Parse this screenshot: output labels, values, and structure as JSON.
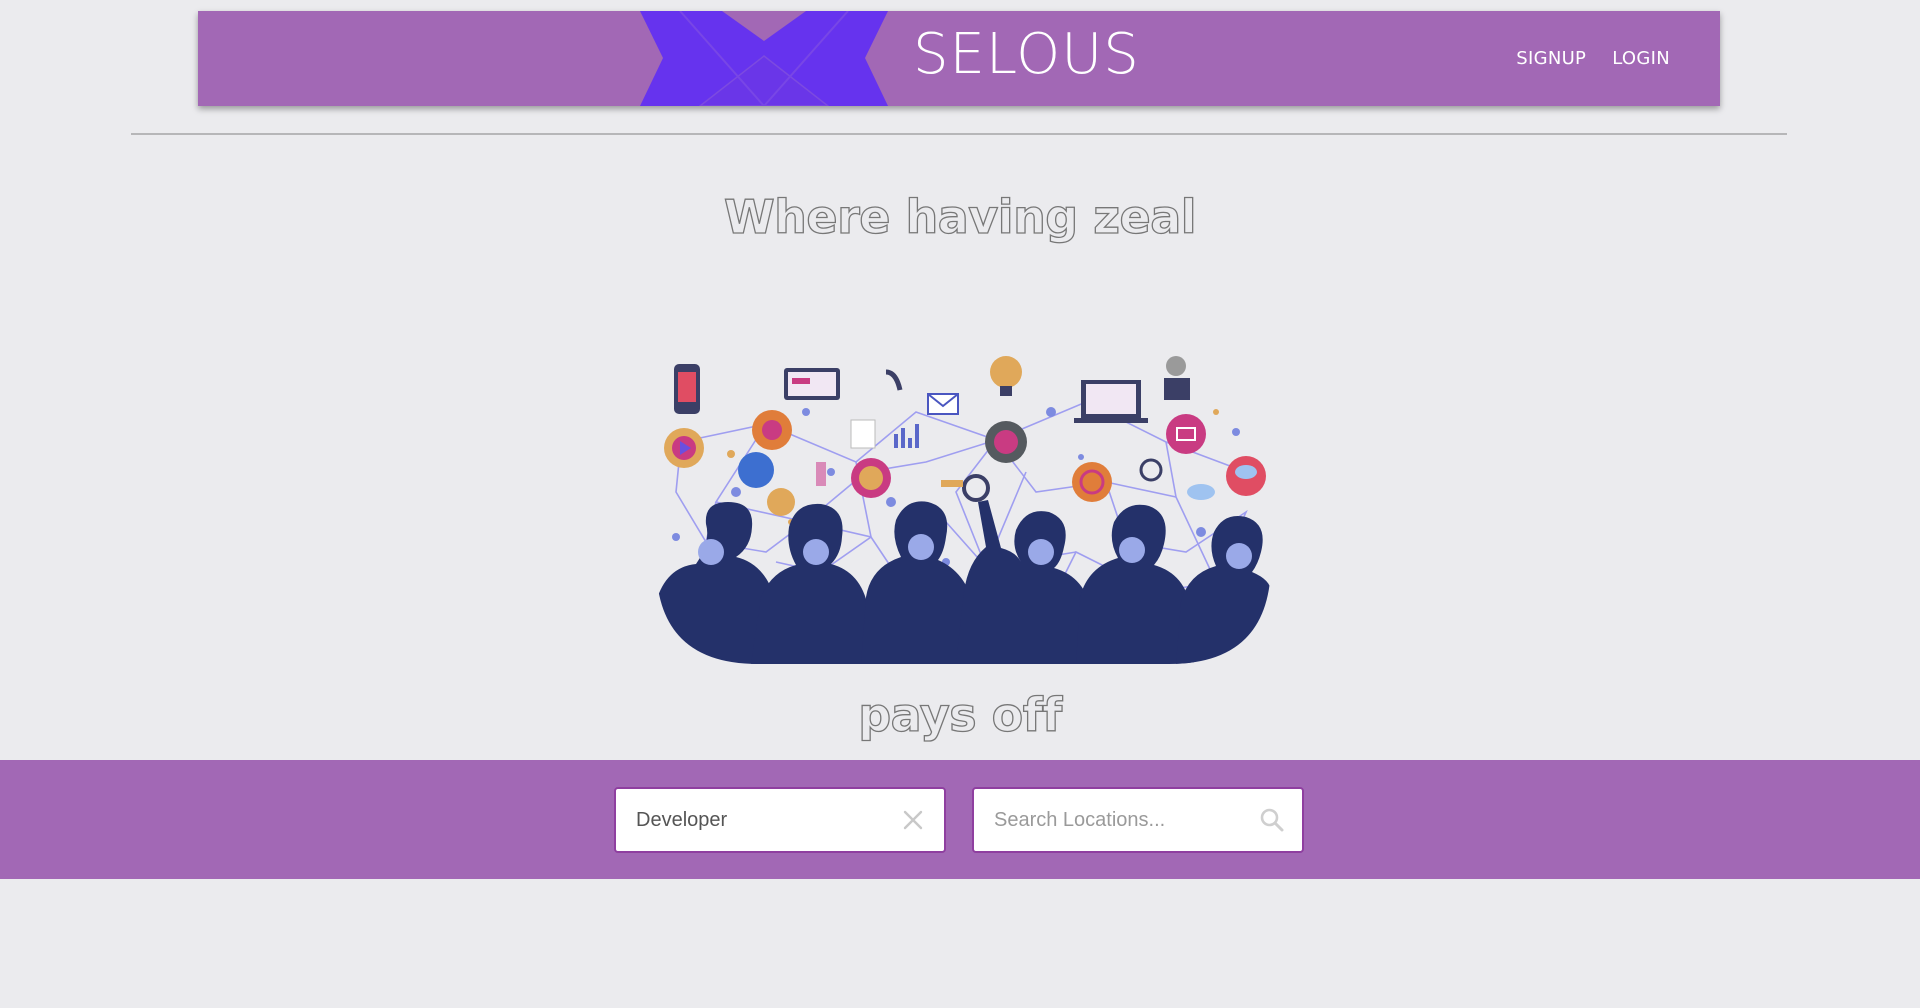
{
  "header": {
    "brand": "SELOUS",
    "nav": {
      "signup": "SIGNUP",
      "login": "LOGIN"
    },
    "logo_icon": "x-logo-icon"
  },
  "hero": {
    "line_top": "Where having zeal",
    "line_bottom": "pays off",
    "illustration_icon": "networking-people-illustration"
  },
  "search": {
    "role_field": {
      "value": "Developer",
      "clear_icon": "close-icon"
    },
    "location_field": {
      "value": "",
      "placeholder": "Search Locations...",
      "icon": "search-icon"
    }
  },
  "colors": {
    "brand_purple": "#a268b5",
    "logo_violet": "#6633ee",
    "page_background": "#ebebee"
  }
}
